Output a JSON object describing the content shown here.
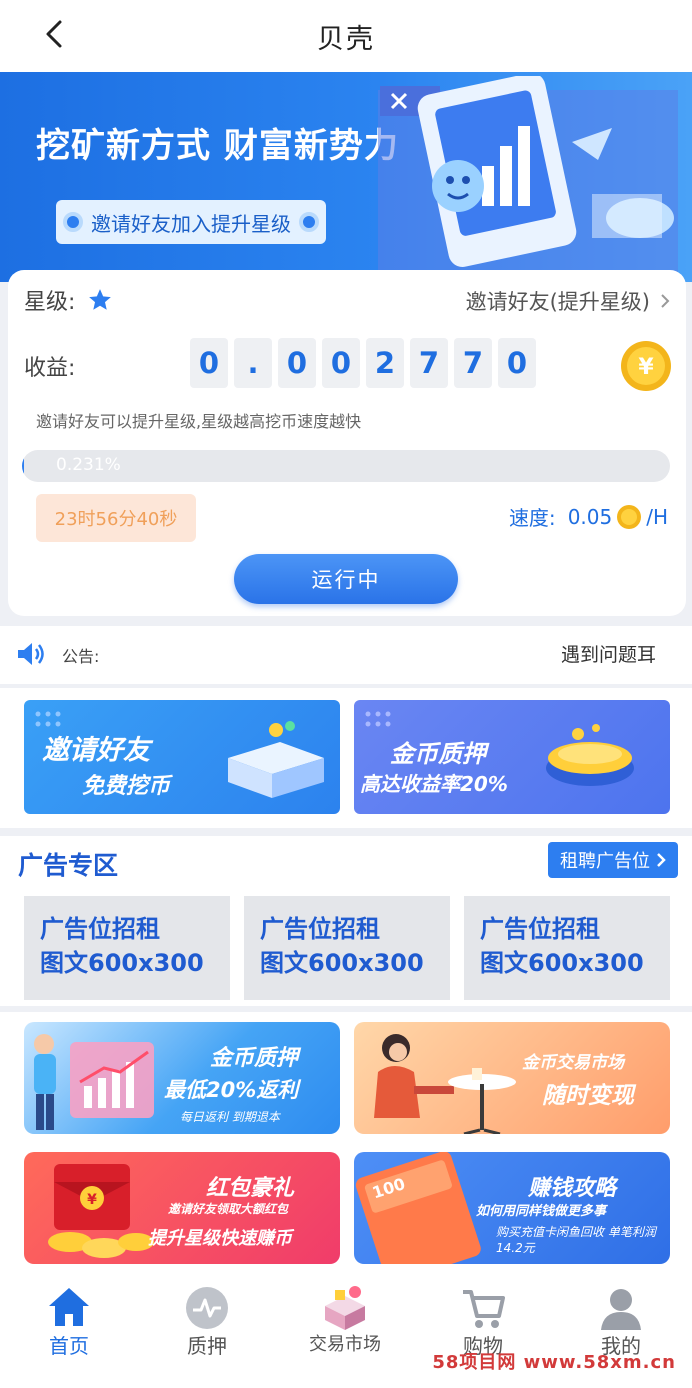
{
  "header": {
    "title": "贝壳"
  },
  "banner": {
    "headline": "挖矿新方式 财富新势力",
    "pill": "邀请好友加入提升星级"
  },
  "mining": {
    "star_label": "星级:",
    "invite_link": "邀请好友(提升星级)",
    "income_label": "收益:",
    "income_digits": [
      "0",
      ".",
      "0",
      "0",
      "2",
      "7",
      "7",
      "0"
    ],
    "hint": "邀请好友可以提升星级,星级越高挖币速度越快",
    "progress_percent": 0.231,
    "progress_text": "0.231%",
    "timer": "23时56分40秒",
    "speed_label": "速度:",
    "speed_value": "0.05",
    "speed_unit": "/H",
    "status_button": "运行中"
  },
  "notice": {
    "label": "公告:",
    "text": "遇到问题耳"
  },
  "promos": [
    {
      "line1": "邀请好友",
      "line2": "免费挖币"
    },
    {
      "line1": "金币质押",
      "line2": "高达收益率20%"
    }
  ],
  "ads": {
    "title": "广告专区",
    "rent_button": "租聘广告位",
    "slots": [
      {
        "line1": "广告位招租",
        "line2": "图文600x300"
      },
      {
        "line1": "广告位招租",
        "line2": "图文600x300"
      },
      {
        "line1": "广告位招租",
        "line2": "图文600x300"
      }
    ]
  },
  "tiles": [
    {
      "title": "金币质押",
      "sub": "最低20%返利",
      "note": "每日返利 到期退本"
    },
    {
      "title": "金币交易市场",
      "sub": "随时变现",
      "note": ""
    },
    {
      "title": "红包豪礼",
      "sub": "邀请好友领取大额红包",
      "note": "提升星级快速赚币"
    },
    {
      "title": "赚钱攻略",
      "sub": "如何用同样钱做更多事",
      "note": "购买充值卡闲鱼回收 单笔利润14.2元"
    }
  ],
  "tabbar": [
    {
      "label": "首页",
      "icon": "home-icon",
      "active": true
    },
    {
      "label": "质押",
      "icon": "pulse-icon",
      "active": false
    },
    {
      "label": "交易市场",
      "icon": "market-icon",
      "active": false
    },
    {
      "label": "购物",
      "icon": "cart-icon",
      "active": false
    },
    {
      "label": "我的",
      "icon": "user-icon",
      "active": false
    }
  ],
  "watermark": "58项目网 www.58xm.cn",
  "colors": {
    "primary": "#2d7ef0",
    "accent_text": "#1f5bd0",
    "timer": "#f0a05a"
  }
}
